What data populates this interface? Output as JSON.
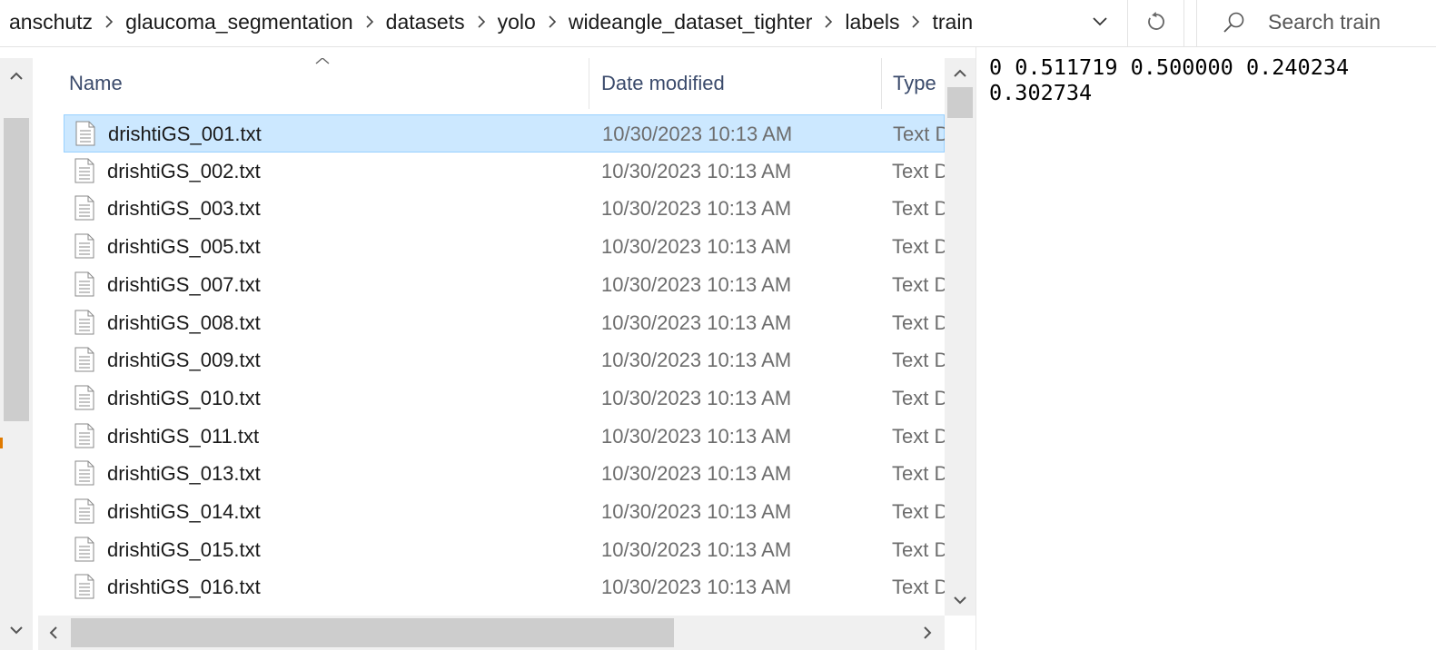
{
  "breadcrumb": {
    "items": [
      "anschutz",
      "glaucoma_segmentation",
      "datasets",
      "yolo",
      "wideangle_dataset_tighter",
      "labels",
      "train"
    ]
  },
  "search": {
    "placeholder": "Search train"
  },
  "columns": {
    "name": "Name",
    "date_modified": "Date modified",
    "type": "Type"
  },
  "files": [
    {
      "name": "drishtiGS_001.txt",
      "date": "10/30/2023 10:13 AM",
      "type": "Text Document",
      "selected": true
    },
    {
      "name": "drishtiGS_002.txt",
      "date": "10/30/2023 10:13 AM",
      "type": "Text Document"
    },
    {
      "name": "drishtiGS_003.txt",
      "date": "10/30/2023 10:13 AM",
      "type": "Text Document"
    },
    {
      "name": "drishtiGS_005.txt",
      "date": "10/30/2023 10:13 AM",
      "type": "Text Document"
    },
    {
      "name": "drishtiGS_007.txt",
      "date": "10/30/2023 10:13 AM",
      "type": "Text Document"
    },
    {
      "name": "drishtiGS_008.txt",
      "date": "10/30/2023 10:13 AM",
      "type": "Text Document"
    },
    {
      "name": "drishtiGS_009.txt",
      "date": "10/30/2023 10:13 AM",
      "type": "Text Document"
    },
    {
      "name": "drishtiGS_010.txt",
      "date": "10/30/2023 10:13 AM",
      "type": "Text Document"
    },
    {
      "name": "drishtiGS_011.txt",
      "date": "10/30/2023 10:13 AM",
      "type": "Text Document"
    },
    {
      "name": "drishtiGS_013.txt",
      "date": "10/30/2023 10:13 AM",
      "type": "Text Document"
    },
    {
      "name": "drishtiGS_014.txt",
      "date": "10/30/2023 10:13 AM",
      "type": "Text Document"
    },
    {
      "name": "drishtiGS_015.txt",
      "date": "10/30/2023 10:13 AM",
      "type": "Text Document"
    },
    {
      "name": "drishtiGS_016.txt",
      "date": "10/30/2023 10:13 AM",
      "type": "Text Document"
    }
  ],
  "preview": {
    "text": "0 0.511719 0.500000 0.240234 0.302734"
  },
  "colors": {
    "selection_bg": "#cce8ff",
    "selection_border": "#99d1ff",
    "header_text": "#3a4a6b"
  }
}
